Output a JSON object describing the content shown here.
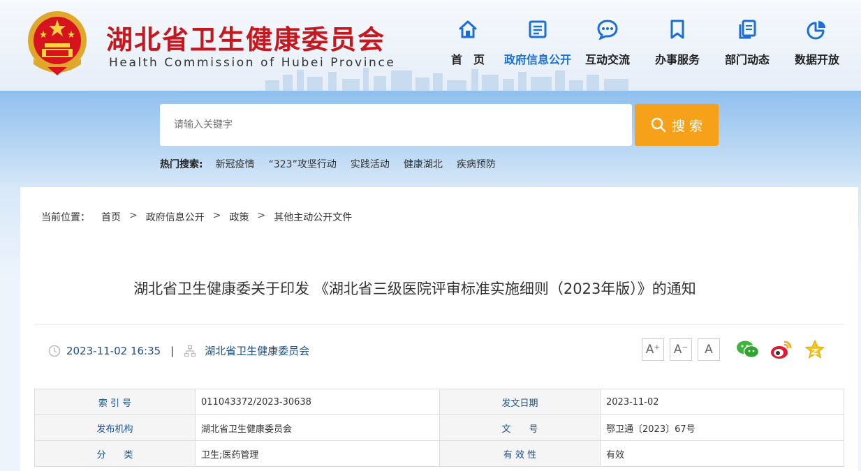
{
  "site": {
    "title": "湖北省卫生健康委员会",
    "subtitle": "Health Commission of Hubei Province"
  },
  "nav": [
    {
      "label": "首　页",
      "icon": "home-icon"
    },
    {
      "label": "政府信息公开",
      "icon": "document-icon",
      "active": true
    },
    {
      "label": "互动交流",
      "icon": "chat-icon"
    },
    {
      "label": "办事服务",
      "icon": "bookmark-icon"
    },
    {
      "label": "部门动态",
      "icon": "copy-icon"
    },
    {
      "label": "数据开放",
      "icon": "pie-chart-icon"
    }
  ],
  "search": {
    "placeholder": "请输入关键字",
    "button_label": "搜 索"
  },
  "hot": {
    "label": "热门搜索:",
    "items": [
      "新冠疫情",
      "“323”攻坚行动",
      "实践活动",
      "健康湖北",
      "疾病预防"
    ]
  },
  "breadcrumb": {
    "prefix": "当前位置：",
    "items": [
      "首页",
      "政府信息公开",
      "政策",
      "其他主动公开文件"
    ],
    "separator": ">"
  },
  "doc": {
    "title": "湖北省卫生健康委关于印发 《湖北省三级医院评审标准实施细则（2023年版）》的通知",
    "datetime": "2023-11-02 16:35",
    "divider": "|",
    "publisher": "湖北省卫生健康委员会"
  },
  "font_buttons": [
    "A⁺",
    "A⁻",
    "A"
  ],
  "shares": [
    "wechat-icon",
    "weibo-icon",
    "favorite-star-icon"
  ],
  "info_table": {
    "rows": [
      {
        "k1": "索 引 号",
        "v1": "011043372/2023-30638",
        "k2": "发文日期",
        "v2": "2023-11-02"
      },
      {
        "k1": "发布机构",
        "v1": "湖北省卫生健康委员会",
        "k2": "文　　号",
        "v2": "鄂卫通〔2023〕67号"
      },
      {
        "k1": "分　　类",
        "v1": "卫生;医药管理",
        "k2": "有 效 性",
        "v2": "有效"
      }
    ]
  },
  "colors": {
    "brand_red": "#c8161d",
    "nav_blue": "#1a6fd6",
    "search_orange": "#f7a11a",
    "meta_blue": "#1a4f8c"
  }
}
